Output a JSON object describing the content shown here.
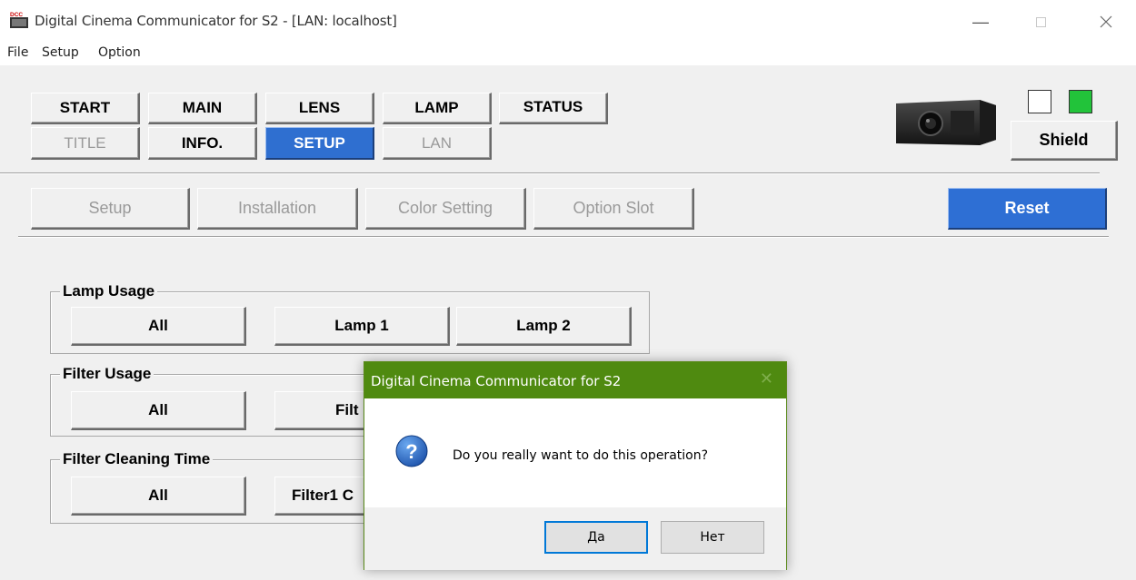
{
  "window": {
    "title": "Digital Cinema Communicator for S2 - [LAN: localhost]",
    "app_icon_text": "DCC"
  },
  "menu": [
    "File",
    "Setup",
    "Option"
  ],
  "nav": {
    "row1": [
      {
        "label": "START",
        "state": "normal"
      },
      {
        "label": "MAIN",
        "state": "normal"
      },
      {
        "label": "LENS",
        "state": "normal"
      },
      {
        "label": "LAMP",
        "state": "normal"
      },
      {
        "label": "STATUS",
        "state": "normal"
      }
    ],
    "row2": [
      {
        "label": "TITLE",
        "state": "disabled"
      },
      {
        "label": "INFO.",
        "state": "normal"
      },
      {
        "label": "SETUP",
        "state": "active"
      },
      {
        "label": "LAN",
        "state": "disabled"
      }
    ],
    "shield_label": "Shield",
    "indicator_colors": [
      "#ffffff",
      "#22c33a"
    ]
  },
  "subtabs": {
    "items": [
      "Setup",
      "Installation",
      "Color Setting",
      "Option Slot"
    ],
    "reset_label": "Reset"
  },
  "groups": [
    {
      "label": "Lamp Usage",
      "buttons": [
        "All",
        "Lamp 1",
        "Lamp 2"
      ]
    },
    {
      "label": "Filter Usage",
      "buttons": [
        "All",
        "Filt"
      ]
    },
    {
      "label": "Filter Cleaning Time",
      "buttons": [
        "All",
        "Filter1 C"
      ]
    }
  ],
  "dialog": {
    "title": "Digital Cinema Communicator for S2",
    "message": "Do you really want to do this operation?",
    "yes_label": "Да",
    "no_label": "Нет",
    "accent_color": "#4f8a10"
  },
  "colors": {
    "active_blue": "#2f6fd0",
    "disabled_text": "#9a9a9a"
  }
}
